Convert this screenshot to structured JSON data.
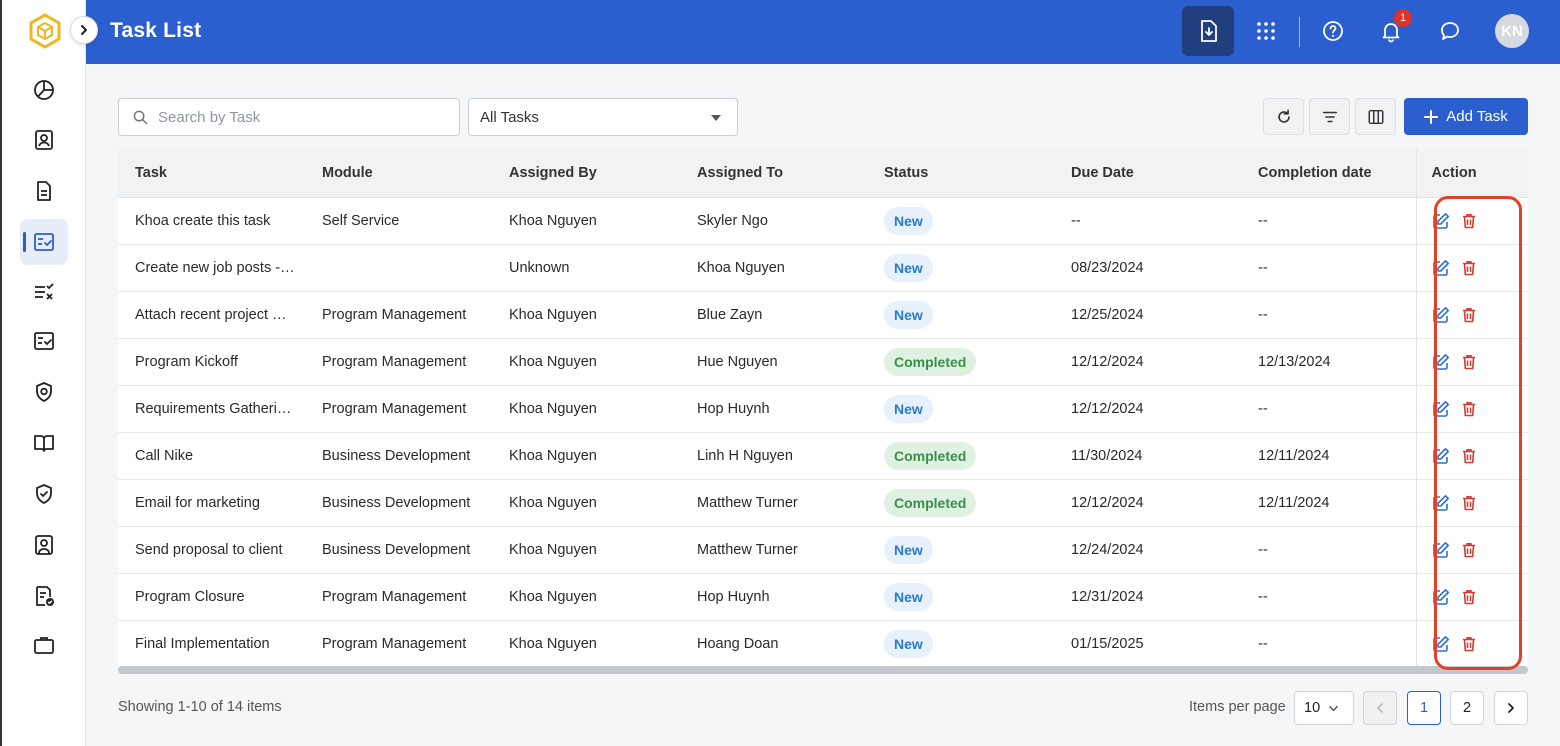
{
  "header": {
    "title": "Task List",
    "notification_count": "1",
    "avatar_initials": "KN",
    "accent": "#2b5fcf"
  },
  "sidebar": {
    "items": [
      {
        "name": "dashboard-icon"
      },
      {
        "name": "contacts-icon"
      },
      {
        "name": "document-icon"
      },
      {
        "name": "task-list-icon",
        "active": true
      },
      {
        "name": "checklist-icon"
      },
      {
        "name": "approvals-icon"
      },
      {
        "name": "badge-icon"
      },
      {
        "name": "book-icon"
      },
      {
        "name": "shield-check-icon"
      },
      {
        "name": "profile-card-icon"
      },
      {
        "name": "report-check-icon"
      },
      {
        "name": "briefcase-icon"
      }
    ]
  },
  "toolbar": {
    "search_placeholder": "Search by Task",
    "filter_value": "All Tasks",
    "add_label": "Add Task"
  },
  "table": {
    "columns": [
      "Task",
      "Module",
      "Assigned By",
      "Assigned To",
      "Status",
      "Due Date",
      "Completion date",
      "Action"
    ],
    "rows": [
      {
        "task": "Khoa create this task",
        "module": "Self Service",
        "by": "Khoa Nguyen",
        "to": "Skyler Ngo",
        "status": "New",
        "due": "--",
        "done": "--"
      },
      {
        "task": "Create new job posts -…",
        "module": "",
        "by": "Unknown",
        "to": "Khoa Nguyen",
        "status": "New",
        "due": "08/23/2024",
        "done": "--"
      },
      {
        "task": "Attach recent project …",
        "module": "Program Management",
        "by": "Khoa Nguyen",
        "to": "Blue Zayn",
        "status": "New",
        "due": "12/25/2024",
        "done": "--"
      },
      {
        "task": "Program Kickoff",
        "module": "Program Management",
        "by": "Khoa Nguyen",
        "to": "Hue Nguyen",
        "status": "Completed",
        "due": "12/12/2024",
        "done": "12/13/2024"
      },
      {
        "task": "Requirements Gatheri…",
        "module": "Program Management",
        "by": "Khoa Nguyen",
        "to": "Hop Huynh",
        "status": "New",
        "due": "12/12/2024",
        "done": "--"
      },
      {
        "task": "Call Nike",
        "module": "Business Development",
        "by": "Khoa Nguyen",
        "to": "Linh H Nguyen",
        "status": "Completed",
        "due": "11/30/2024",
        "done": "12/11/2024"
      },
      {
        "task": "Email for marketing",
        "module": "Business Development",
        "by": "Khoa Nguyen",
        "to": "Matthew Turner",
        "status": "Completed",
        "due": "12/12/2024",
        "done": "12/11/2024"
      },
      {
        "task": "Send proposal to client",
        "module": "Business Development",
        "by": "Khoa Nguyen",
        "to": "Matthew Turner",
        "status": "New",
        "due": "12/24/2024",
        "done": "--"
      },
      {
        "task": "Program Closure",
        "module": "Program Management",
        "by": "Khoa Nguyen",
        "to": "Hop Huynh",
        "status": "New",
        "due": "12/31/2024",
        "done": "--"
      },
      {
        "task": "Final Implementation",
        "module": "Program Management",
        "by": "Khoa Nguyen",
        "to": "Hoang Doan",
        "status": "New",
        "due": "01/15/2025",
        "done": "--"
      }
    ]
  },
  "footer": {
    "showing": "Showing 1-10 of 14 items",
    "items_per_page_label": "Items per page",
    "items_per_page_value": "10",
    "pages": [
      "1",
      "2"
    ],
    "current_page": "1"
  }
}
